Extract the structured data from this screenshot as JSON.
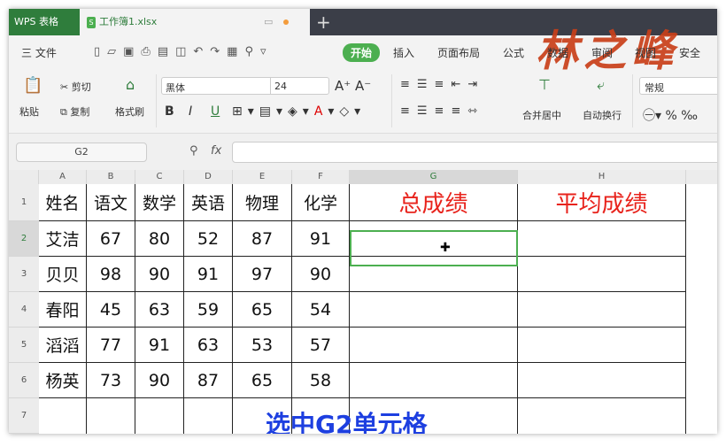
{
  "app": {
    "name": "WPS 表格",
    "doc_tab": "工作簿1.xlsx",
    "new_tab": "+"
  },
  "watermark": "林之峰",
  "menu": {
    "file": "三 文件",
    "items": [
      "开始",
      "插入",
      "页面布局",
      "公式",
      "数据",
      "审阅",
      "视图",
      "安全"
    ]
  },
  "ribbon": {
    "paste": "粘贴",
    "cut": "剪切",
    "copy": "复制",
    "format_painter": "格式刷",
    "font": "黑体",
    "size": "24",
    "merge": "合并居中",
    "wrap": "自动换行",
    "number_format": "常规",
    "bold": "B",
    "italic": "I",
    "underline": "U"
  },
  "formula_bar": {
    "cell_ref": "G2",
    "fx": "fx",
    "value": ""
  },
  "columns": [
    "A",
    "B",
    "C",
    "D",
    "E",
    "F",
    "G",
    "H"
  ],
  "rows": [
    "1",
    "2",
    "3",
    "4",
    "5",
    "6",
    "7"
  ],
  "header": [
    "姓名",
    "语文",
    "数学",
    "英语",
    "物理",
    "化学",
    "总成绩",
    "平均成绩"
  ],
  "data": [
    [
      "艾洁",
      "67",
      "80",
      "52",
      "87",
      "91"
    ],
    [
      "贝贝",
      "98",
      "90",
      "91",
      "97",
      "90"
    ],
    [
      "春阳",
      "45",
      "63",
      "59",
      "65",
      "54"
    ],
    [
      "滔滔",
      "77",
      "91",
      "63",
      "53",
      "57"
    ],
    [
      "杨英",
      "73",
      "90",
      "87",
      "65",
      "58"
    ]
  ],
  "caption": "选中G2单元格",
  "colors": {
    "accent": "#4caf50",
    "header_red": "#e8231c",
    "caption_blue": "#1d3fe0"
  }
}
